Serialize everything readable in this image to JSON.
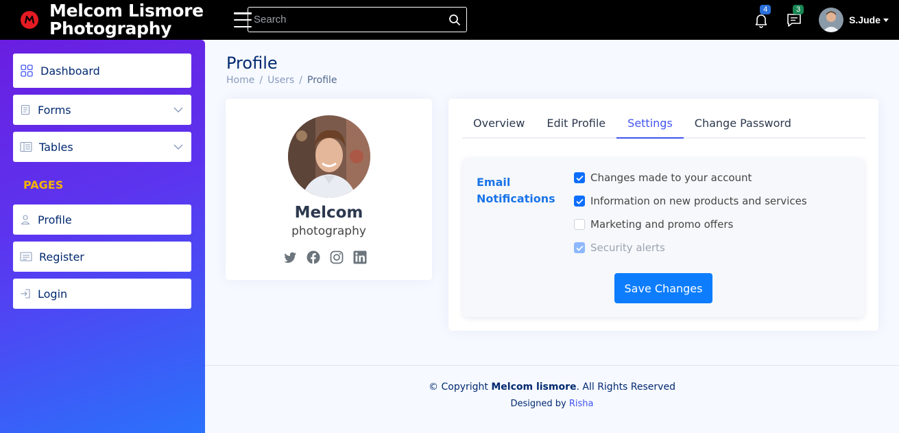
{
  "header": {
    "brand_line1": "Melcom Lismore",
    "brand_line2": "Photography",
    "search_placeholder": "Search",
    "notifications_count": "4",
    "messages_count": "3",
    "user_name": "S.Jude"
  },
  "sidebar": {
    "items": [
      {
        "label": "Dashboard",
        "icon": "grid-icon"
      },
      {
        "label": "Forms",
        "icon": "journal-text-icon"
      },
      {
        "label": "Tables",
        "icon": "layout-text-sidebar-icon"
      }
    ],
    "pages_heading": "PAGES",
    "pages": [
      {
        "label": "Profile",
        "icon": "person-icon"
      },
      {
        "label": "Register",
        "icon": "card-list-icon"
      },
      {
        "label": "Login",
        "icon": "box-arrow-in-right-icon"
      }
    ]
  },
  "main": {
    "title": "Profile",
    "breadcrumb": [
      "Home",
      "Users",
      "Profile"
    ]
  },
  "profile_card": {
    "name": "Melcom",
    "subtitle": "photography",
    "socials": [
      "twitter-icon",
      "facebook-icon",
      "instagram-icon",
      "linkedin-icon"
    ]
  },
  "tabs": {
    "items": [
      "Overview",
      "Edit Profile",
      "Settings",
      "Change Password"
    ],
    "active": "Settings"
  },
  "settings": {
    "email_label_line1": "Email",
    "email_label_line2": "Notifications",
    "options": [
      {
        "label": "Changes made to your account",
        "checked": true,
        "disabled": false
      },
      {
        "label": "Information on new products and services",
        "checked": true,
        "disabled": false
      },
      {
        "label": "Marketing and promo offers",
        "checked": false,
        "disabled": false
      },
      {
        "label": "Security alerts",
        "checked": true,
        "disabled": true
      }
    ],
    "save_label": "Save Changes"
  },
  "footer": {
    "copyright_prefix": "© Copyright ",
    "copyright_brand": "Melcom lismore",
    "copyright_suffix": ". All Rights Reserved",
    "designed_by_prefix": "Designed by ",
    "designer": "Risha"
  },
  "colors": {
    "header_bg": "#000000",
    "accent": "#4154f1",
    "primary_button": "#0d7dfd",
    "sidebar_gradient_start": "#6a1ee0",
    "sidebar_gradient_end": "#2a72fb",
    "pages_heading": "#f4b400"
  }
}
